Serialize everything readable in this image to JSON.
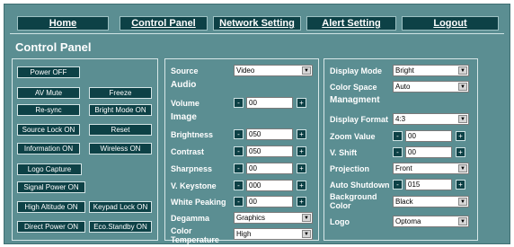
{
  "nav": {
    "home": "Home",
    "control_panel": "Control Panel",
    "network_setting": "Network Setting",
    "alert_setting": "Alert Setting",
    "logout": "Logout"
  },
  "page_title": "Control Panel",
  "controls": {
    "power_off": "Power OFF",
    "av_mute": "AV Mute",
    "freeze": "Freeze",
    "resync": "Re-sync",
    "bright_mode": "Bright Mode ON",
    "source_lock": "Source Lock ON",
    "reset": "Reset",
    "information": "Information ON",
    "wireless": "Wireless ON",
    "logo_capture": "Logo Capture",
    "signal_power": "Signal Power ON",
    "high_altitude": "High Altitude ON",
    "keypad_lock": "Keypad Lock ON",
    "direct_power": "Direct Power ON",
    "eco_standby": "Eco.Standby ON"
  },
  "middle": {
    "source_label": "Source",
    "source_value": "Video",
    "audio_heading": "Audio",
    "volume_label": "Volume",
    "volume_value": "00",
    "image_heading": "Image",
    "brightness_label": "Brightness",
    "brightness_value": "050",
    "contrast_label": "Contrast",
    "contrast_value": "050",
    "sharpness_label": "Sharpness",
    "sharpness_value": "00",
    "vkeystone_label": "V. Keystone",
    "vkeystone_value": "000",
    "white_peaking_label": "White Peaking",
    "white_peaking_value": "00",
    "degamma_label": "Degamma",
    "degamma_value": "Graphics",
    "color_temp_label_1": "Color",
    "color_temp_label_2": "Temperature",
    "color_temp_value": "High"
  },
  "right": {
    "display_mode_label": "Display Mode",
    "display_mode_value": "Bright",
    "color_space_label": "Color Space",
    "color_space_value": "Auto",
    "management_heading": "Managment",
    "display_format_label": "Display Format",
    "display_format_value": "4:3",
    "zoom_label": "Zoom Value",
    "zoom_value": "00",
    "vshift_label": "V. Shift",
    "vshift_value": "00",
    "projection_label": "Projection",
    "projection_value": "Front",
    "auto_shutdown_label": "Auto Shutdown",
    "auto_shutdown_value": "015",
    "bg_color_label_1": "Background",
    "bg_color_label_2": "Color",
    "bg_color_value": "Black",
    "logo_label": "Logo",
    "logo_value": "Optoma"
  },
  "glyphs": {
    "minus": "-",
    "plus": "+",
    "arrow": "▼"
  },
  "colors": {
    "background": "#5b8e92",
    "button": "#0d4146"
  }
}
